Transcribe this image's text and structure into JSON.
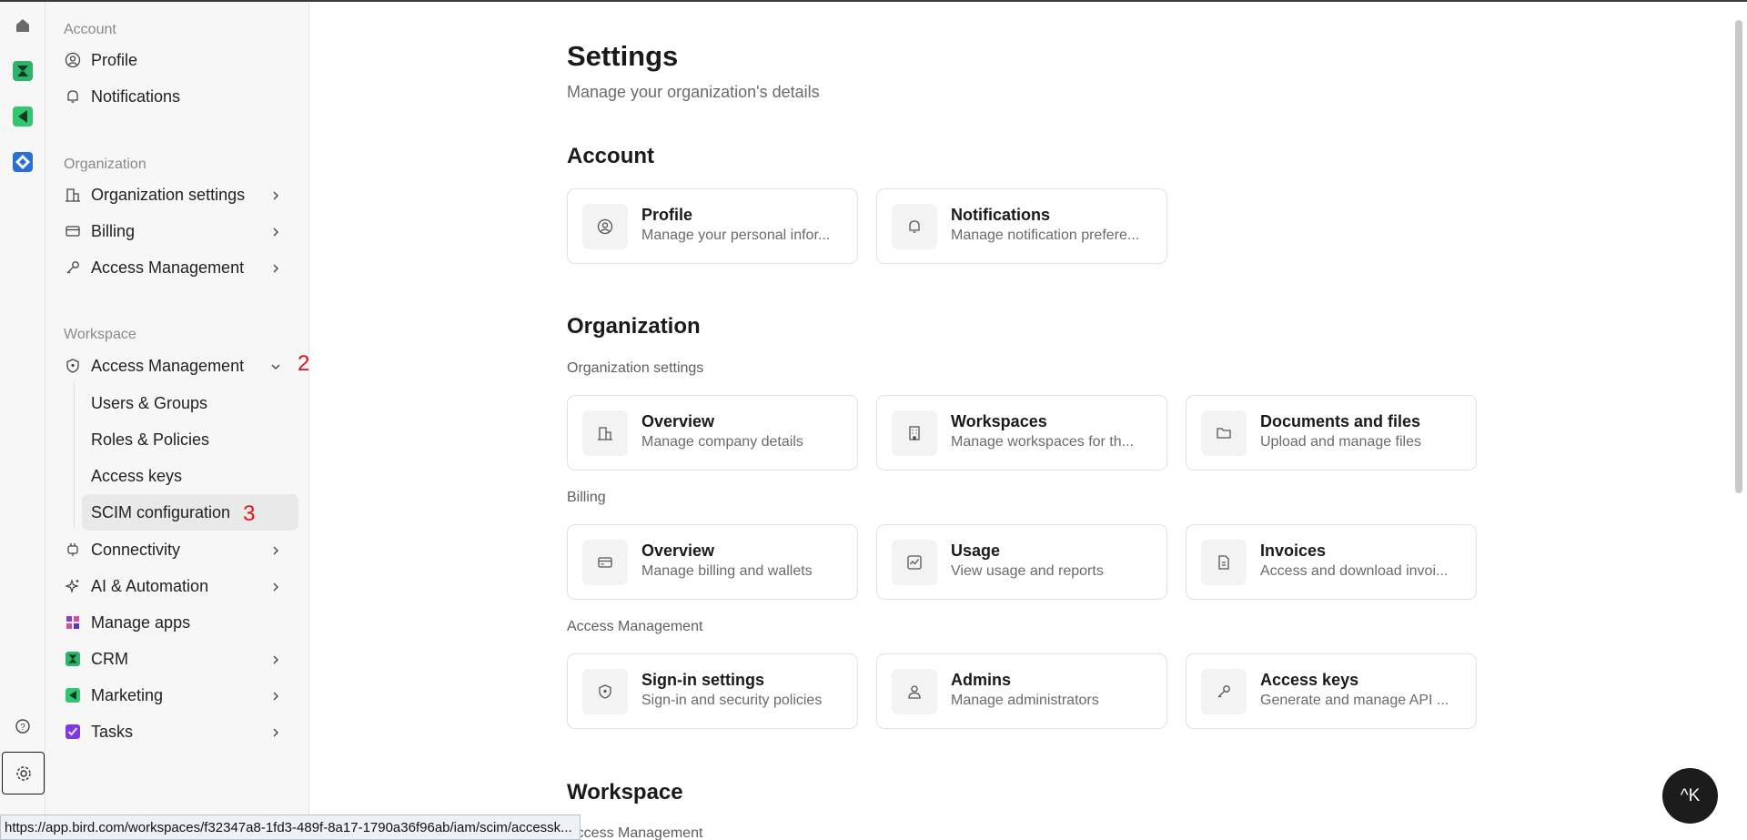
{
  "sidebar": {
    "account_label": "Account",
    "account_items": [
      {
        "label": "Profile",
        "icon": "user-circle-icon"
      },
      {
        "label": "Notifications",
        "icon": "bell-icon"
      }
    ],
    "organization_label": "Organization",
    "organization_items": [
      {
        "label": "Organization settings",
        "icon": "building-icon"
      },
      {
        "label": "Billing",
        "icon": "credit-card-icon"
      },
      {
        "label": "Access Management",
        "icon": "key-icon"
      }
    ],
    "workspace_label": "Workspace",
    "workspace_access": {
      "label": "Access Management",
      "icon": "shield-icon",
      "marker": "2"
    },
    "workspace_access_children": [
      {
        "label": "Users & Groups"
      },
      {
        "label": "Roles & Policies"
      },
      {
        "label": "Access keys"
      },
      {
        "label": "SCIM configuration",
        "marker": "3",
        "active": true
      }
    ],
    "workspace_items": [
      {
        "label": "Connectivity",
        "icon": "plug-icon"
      },
      {
        "label": "AI & Automation",
        "icon": "sparkles-icon"
      },
      {
        "label": "Manage apps",
        "icon": "apps-grid-icon"
      },
      {
        "label": "CRM",
        "icon": "crm-app-icon"
      },
      {
        "label": "Marketing",
        "icon": "marketing-app-icon"
      },
      {
        "label": "Tasks",
        "icon": "tasks-app-icon"
      }
    ]
  },
  "main": {
    "title": "Settings",
    "subtitle": "Manage your organization's details",
    "account": {
      "heading": "Account",
      "cards": [
        {
          "title": "Profile",
          "desc": "Manage your personal infor...",
          "icon": "user-circle-icon"
        },
        {
          "title": "Notifications",
          "desc": "Manage notification prefere...",
          "icon": "bell-icon"
        }
      ]
    },
    "organization": {
      "heading": "Organization",
      "org_settings_label": "Organization settings",
      "org_settings_cards": [
        {
          "title": "Overview",
          "desc": "Manage company details",
          "icon": "building-icon"
        },
        {
          "title": "Workspaces",
          "desc": "Manage workspaces for th...",
          "icon": "office-icon"
        },
        {
          "title": "Documents and files",
          "desc": "Upload and manage files",
          "icon": "folder-icon"
        }
      ],
      "billing_label": "Billing",
      "billing_cards": [
        {
          "title": "Overview",
          "desc": "Manage billing and wallets",
          "icon": "credit-card-icon"
        },
        {
          "title": "Usage",
          "desc": "View usage and reports",
          "icon": "chart-icon"
        },
        {
          "title": "Invoices",
          "desc": "Access and download invoi...",
          "icon": "invoice-icon"
        }
      ],
      "access_label": "Access Management",
      "access_cards": [
        {
          "title": "Sign-in settings",
          "desc": "Sign-in and security policies",
          "icon": "shield-icon"
        },
        {
          "title": "Admins",
          "desc": "Manage administrators",
          "icon": "user-icon"
        },
        {
          "title": "Access keys",
          "desc": "Generate and manage API ...",
          "icon": "key-icon"
        }
      ]
    },
    "workspace": {
      "heading": "Workspace",
      "access_label": "Access Management"
    }
  },
  "cmdk_label": "^K",
  "status_url": "https://app.bird.com/workspaces/f32347a8-1fd3-489f-8a17-1790a36f96ab/iam/scim/accessk..."
}
